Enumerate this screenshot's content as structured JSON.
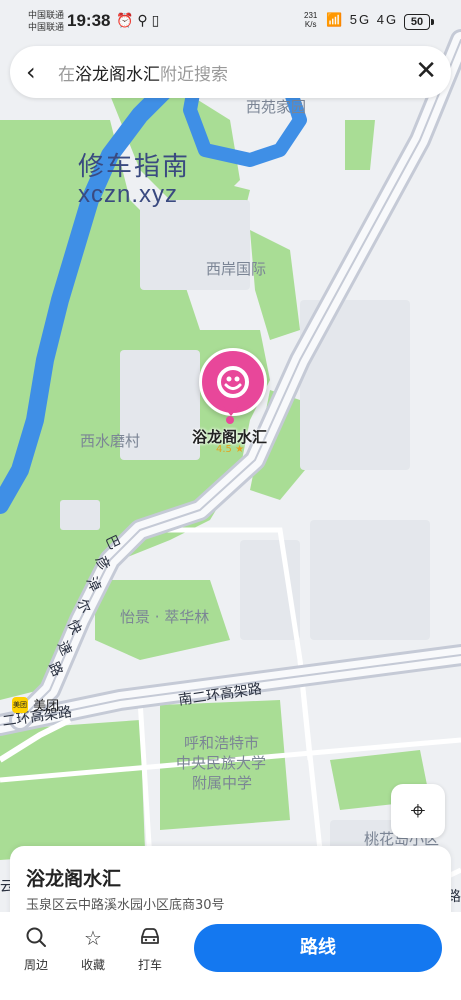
{
  "status_bar": {
    "carrier_1": "中国联通",
    "carrier_2": "中国联通",
    "time": "19:38",
    "left_icons": "⏰⚲▯",
    "net_speed_value": "231",
    "net_speed_unit": "K/s",
    "right_icons": "📶 5G 4G",
    "battery": "50"
  },
  "search_bar": {
    "prefix": "在",
    "place": "浴龙阁水汇",
    "suffix": "附近搜索",
    "back_icon": "chevron-left-icon",
    "close_icon": "close-icon"
  },
  "watermark": {
    "line1": "修车指南",
    "line2": "xczn.xyz"
  },
  "map_labels": [
    "西苑家园",
    "西岸国际",
    "西水磨村",
    "巴",
    "彦",
    "淖",
    "尔",
    "快",
    "速",
    "路",
    "怡景 · 萃华林",
    "南二环高架路",
    "二环高架路",
    "呼和浩特市",
    "中央民族大学",
    "附属中学",
    "桃花岛小区",
    "云",
    "路"
  ],
  "poi": {
    "name": "浴龙阁水汇",
    "rating": "4.5 ★",
    "pin_color": "#e8479a"
  },
  "meituan": {
    "icon_text": "美团",
    "label": "美团"
  },
  "place_card": {
    "name": "浴龙阁水汇",
    "address": "玉泉区云中路溪水园小区底商30号"
  },
  "actions": {
    "nearby": {
      "icon": "search-icon",
      "label": "周边"
    },
    "favorite": {
      "icon": "star-icon",
      "label": "收藏"
    },
    "taxi": {
      "icon": "car-icon",
      "label": "打车"
    },
    "route": {
      "label": "路线",
      "color": "#1478f0"
    }
  },
  "colors": {
    "park_green": "#a9dd95",
    "river_blue": "#3f8fe6",
    "road_grey": "#c5cad6",
    "map_bg": "#eef0f3"
  }
}
